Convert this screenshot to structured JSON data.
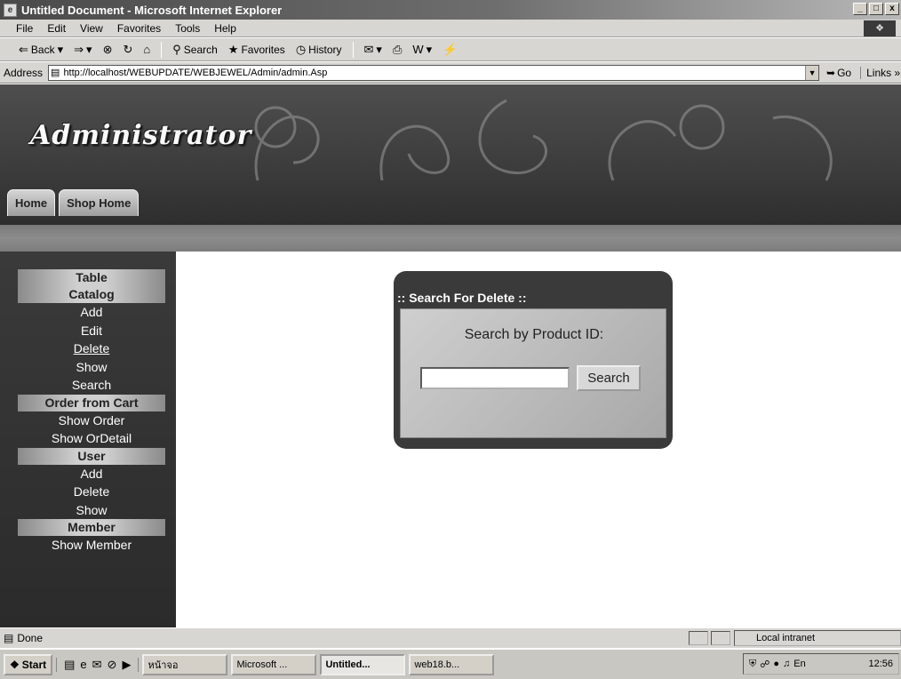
{
  "window": {
    "title": "Untitled Document - Microsoft Internet Explorer",
    "controls": [
      "_",
      "□",
      "x"
    ]
  },
  "menu": [
    "File",
    "Edit",
    "View",
    "Favorites",
    "Tools",
    "Help"
  ],
  "toolbar": {
    "back": "Back",
    "search": "Search",
    "favorites": "Favorites",
    "history": "History"
  },
  "address": {
    "label": "Address",
    "url": "http://localhost/WEBUPDATE/WEBJEWEL/Admin/admin.Asp",
    "go": "Go",
    "links": "Links »"
  },
  "page": {
    "banner_title": "Administrator",
    "tabs": [
      "Home",
      "Shop Home"
    ],
    "sidebar": {
      "sections": [
        {
          "items": [
            {
              "label": "Table",
              "type": "head"
            },
            {
              "label": "Catalog",
              "type": "head"
            },
            {
              "label": "Add",
              "type": "link"
            },
            {
              "label": "Edit",
              "type": "link"
            },
            {
              "label": "Delete",
              "type": "link",
              "active": true
            },
            {
              "label": "Show",
              "type": "link"
            },
            {
              "label": "Search",
              "type": "link"
            },
            {
              "label": "Order from Cart",
              "type": "head"
            },
            {
              "label": "Show Order",
              "type": "link"
            },
            {
              "label": "Show OrDetail",
              "type": "link"
            },
            {
              "label": "User",
              "type": "head"
            },
            {
              "label": "Add",
              "type": "link"
            },
            {
              "label": "Delete",
              "type": "link"
            },
            {
              "label": "Show",
              "type": "link"
            },
            {
              "label": "Member",
              "type": "head"
            },
            {
              "label": "Show Member",
              "type": "link"
            }
          ]
        }
      ]
    },
    "search_box": {
      "title": ":: Search For Delete ::",
      "label": "Search by Product ID:",
      "input_value": "",
      "button": "Search"
    }
  },
  "status": {
    "text": "Done",
    "zone": "Local intranet"
  },
  "taskbar": {
    "start": "Start",
    "tasks": [
      {
        "label": "หน้าจอ",
        "active": false
      },
      {
        "label": "Microsoft ...",
        "active": false
      },
      {
        "label": "Untitled...",
        "active": true
      },
      {
        "label": "web18.b...",
        "active": false
      }
    ],
    "clock": "12:56"
  }
}
